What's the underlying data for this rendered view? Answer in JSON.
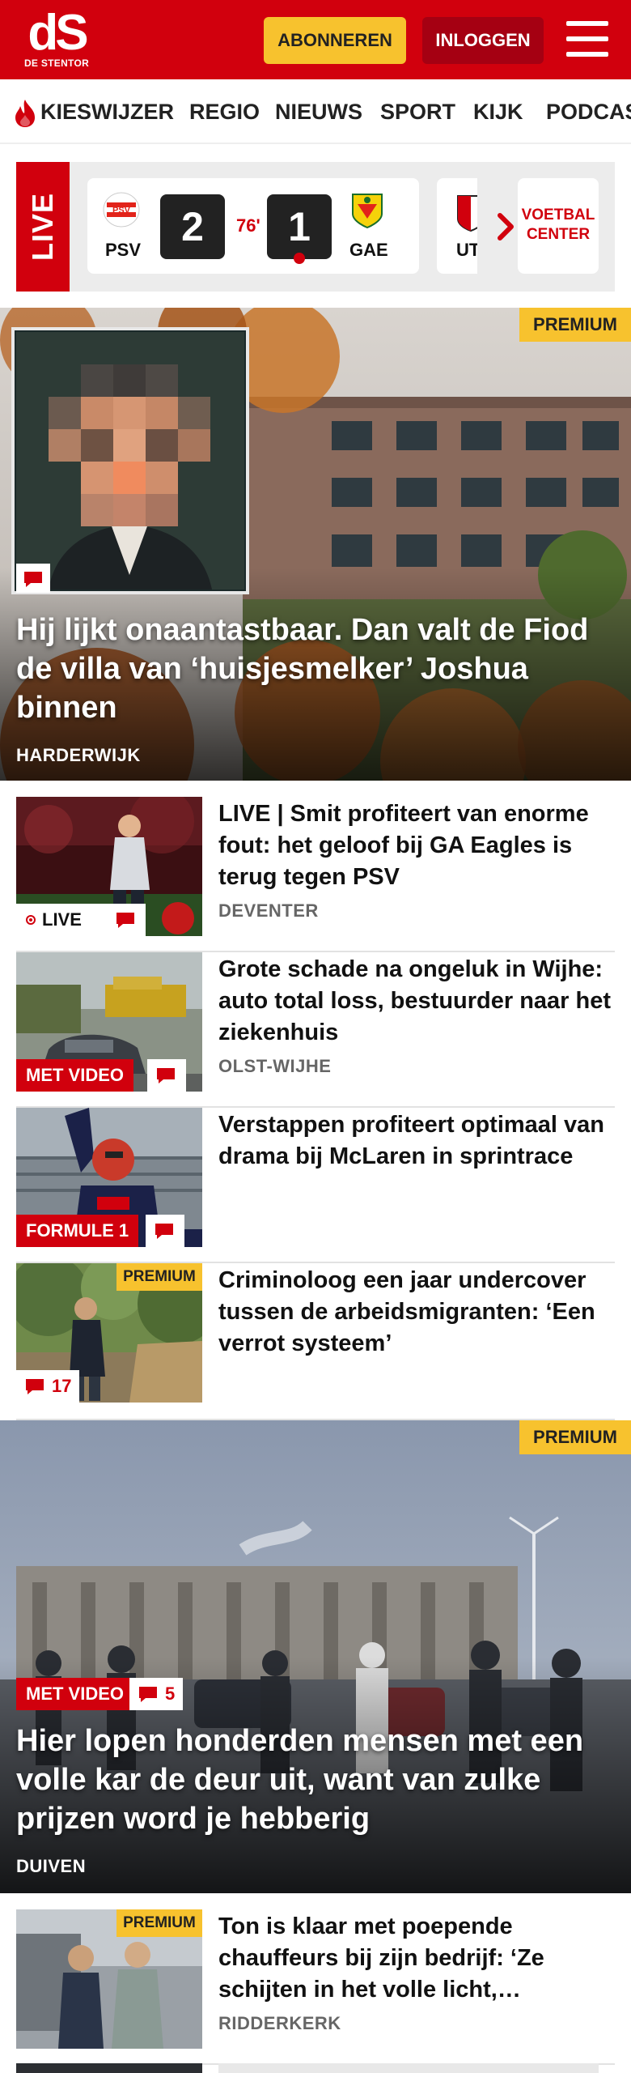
{
  "header": {
    "logo_mark": "dS",
    "logo_text": "DE STENTOR",
    "subscribe_label": "ABONNEREN",
    "login_label": "INLOGGEN",
    "brand_color": "#d1000d",
    "accent_color": "#f7c22e"
  },
  "nav": {
    "items": [
      "KIESWIJZER",
      "REGIO",
      "NIEUWS",
      "SPORT",
      "KIJK",
      "PODCAS"
    ]
  },
  "live": {
    "label": "LIVE",
    "match": {
      "home_abbr": "PSV",
      "home_score": "2",
      "minute": "76'",
      "away_score": "1",
      "away_abbr": "GAE"
    },
    "next_abbr": "UT",
    "center_label": "VOETBAL CENTER"
  },
  "hero1": {
    "badge": "PREMIUM",
    "title": "Hij lijkt onaantastbaar. Dan valt de Fiod de villa van ‘huisjesmelker’ Joshua binnen",
    "location": "HARDERWIJK"
  },
  "articles": [
    {
      "title": "LIVE | Smit profiteert van enorme fout: het geloof bij GA Eagles is terug tegen PSV",
      "location": "DEVENTER",
      "tag": "LIVE"
    },
    {
      "title": "Grote schade na ongeluk in Wijhe: auto total loss, bestuurder naar het ziekenhuis",
      "location": "OLST-WIJHE",
      "tag": "MET VIDEO"
    },
    {
      "title": "Verstappen profiteert optimaal van drama bij McLaren in sprintrace",
      "location": "",
      "tag": "FORMULE 1"
    },
    {
      "title": "Criminoloog een jaar undercover tussen de arbeidsmigranten: ‘Een verrot systeem’",
      "location": "",
      "tag": "PREMIUM",
      "comments": "17"
    }
  ],
  "hero2": {
    "badge": "PREMIUM",
    "tag": "MET VIDEO",
    "comments": "5",
    "title": "Hier lopen honderden mensen met een volle kar de deur uit, want van zulke prijzen word je hebberig",
    "location": "DUIVEN"
  },
  "article5": {
    "badge": "PREMIUM",
    "title": "Ton is klaar met poepende chauffeurs bij zijn bedrijf: ‘Ze schijten in het volle licht,…",
    "location": "RIDDERKERK"
  }
}
